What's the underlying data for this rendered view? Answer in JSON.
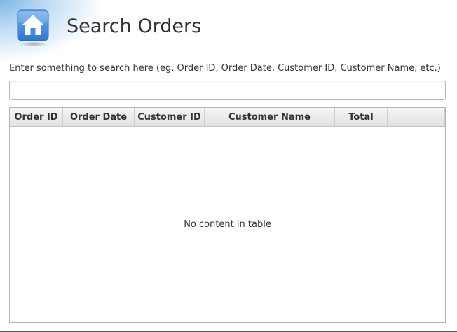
{
  "header": {
    "title": "Search Orders",
    "icon": "home-icon"
  },
  "search": {
    "label": "Enter something to search here (eg. Order ID, Order Date, Customer ID, Customer Name, etc.)",
    "value": "",
    "placeholder": ""
  },
  "table": {
    "columns": [
      "Order ID",
      "Order Date",
      "Customer ID",
      "Customer Name",
      "Total"
    ],
    "rows": [],
    "empty_message": "No content in table"
  },
  "colors": {
    "icon_blue": "#3f8ddf",
    "header_gradient_top": "#f6f6f6",
    "header_gradient_bottom": "#e2e2e2"
  }
}
